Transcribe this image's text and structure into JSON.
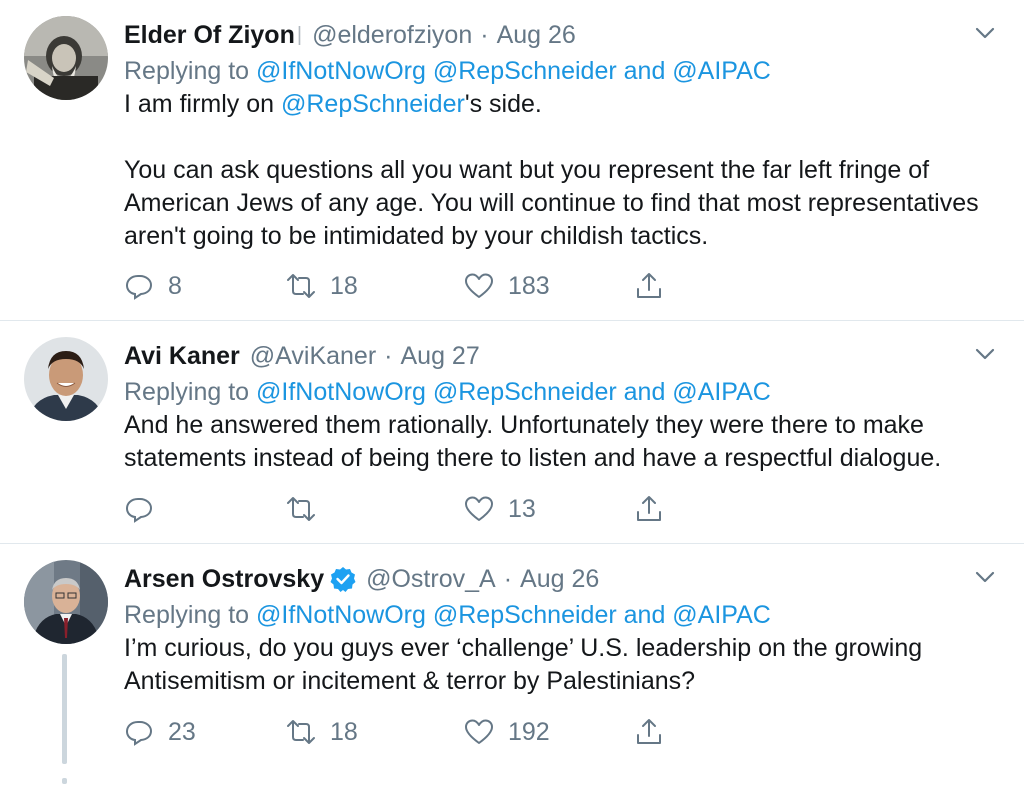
{
  "tweets": [
    {
      "name": "Elder Of Ziyon",
      "name_suffix": "|",
      "handle": "@elderofziyon",
      "date": "Aug 26",
      "replying_prefix": "Replying to ",
      "reply_to_1": "@IfNotNowOrg",
      "reply_to_2": "@RepSchneider",
      "reply_and": " and ",
      "reply_to_3": "@AIPAC",
      "body_pre": "I am firmly on ",
      "body_mention": "@RepSchneider",
      "body_post": "'s side.\n\nYou can ask questions all you want but you represent the far left fringe of American Jews of any age.  You will continue to find that most representatives aren't going to be intimidated by your childish tactics.",
      "replies": "8",
      "retweets": "18",
      "likes": "183"
    },
    {
      "name": "Avi Kaner",
      "handle": "@AviKaner",
      "date": "Aug 27",
      "replying_prefix": "Replying to ",
      "reply_to_1": "@IfNotNowOrg",
      "reply_to_2": "@RepSchneider",
      "reply_and": " and ",
      "reply_to_3": "@AIPAC",
      "body": "And he answered them rationally. Unfortunately they were there to make statements instead of being there to listen and have a respectful dialogue.",
      "replies": "",
      "retweets": "",
      "likes": "13"
    },
    {
      "name": "Arsen Ostrovsky",
      "handle": "@Ostrov_A",
      "date": "Aug 26",
      "replying_prefix": "Replying to ",
      "reply_to_1": "@IfNotNowOrg",
      "reply_to_2": "@RepSchneider",
      "reply_and": " and ",
      "reply_to_3": "@AIPAC",
      "body": "I’m curious, do you guys ever ‘challenge’ U.S. leadership on the growing Antisemitism or incitement & terror by Palestinians?",
      "replies": "23",
      "retweets": "18",
      "likes": "192"
    }
  ],
  "separator": "·",
  "colors": {
    "link": "#1b95e0",
    "muted": "#657786",
    "verified": "#1da1f2",
    "divider": "#e1e8ed"
  },
  "icons": [
    "reply-icon",
    "retweet-icon",
    "like-icon",
    "share-icon",
    "chevron-down-icon",
    "verified-badge-icon"
  ]
}
